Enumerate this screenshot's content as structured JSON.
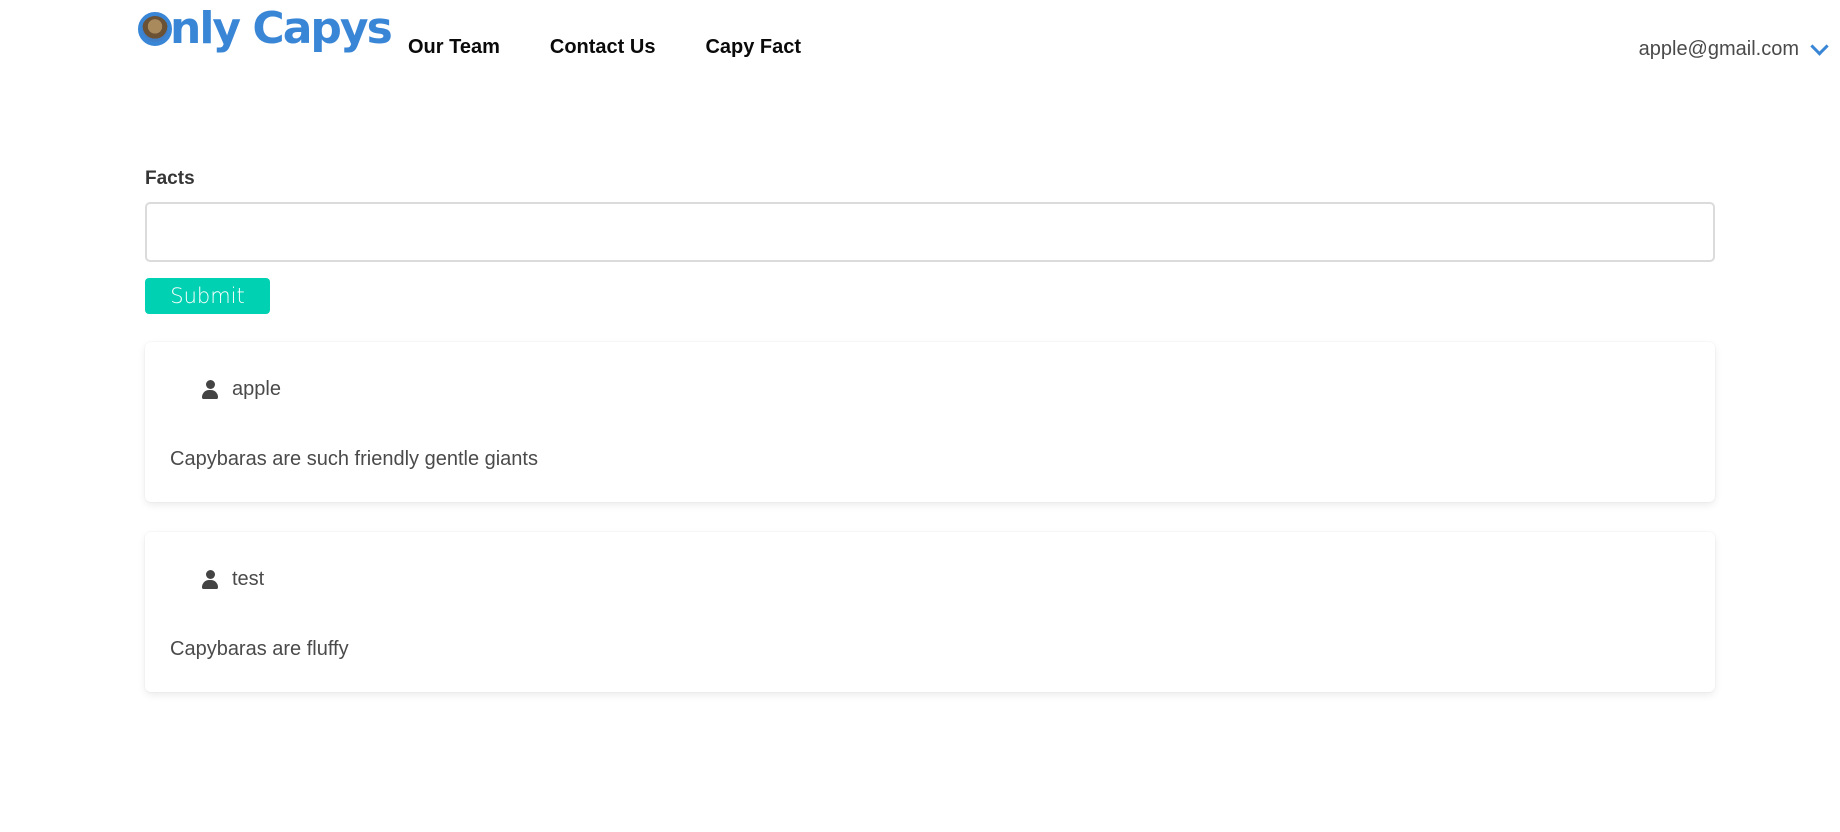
{
  "brand": {
    "logo_text": "nly Capys",
    "logo_letter": "O"
  },
  "nav": {
    "links": [
      {
        "label": "Our Team"
      },
      {
        "label": "Contact Us"
      },
      {
        "label": "Capy Fact"
      }
    ]
  },
  "user_menu": {
    "email": "apple@gmail.com",
    "icon": "chevron-down-icon"
  },
  "form": {
    "label": "Facts",
    "input_value": "",
    "input_placeholder": "",
    "submit_label": "Submit"
  },
  "facts": [
    {
      "user": "apple",
      "text": "Capybaras are such friendly gentle giants",
      "icon": "user-icon"
    },
    {
      "user": "test",
      "text": "Capybaras are fluffy",
      "icon": "user-icon"
    }
  ],
  "colors": {
    "brand_blue": "#3a86d6",
    "submit_teal": "#00d1b2"
  }
}
